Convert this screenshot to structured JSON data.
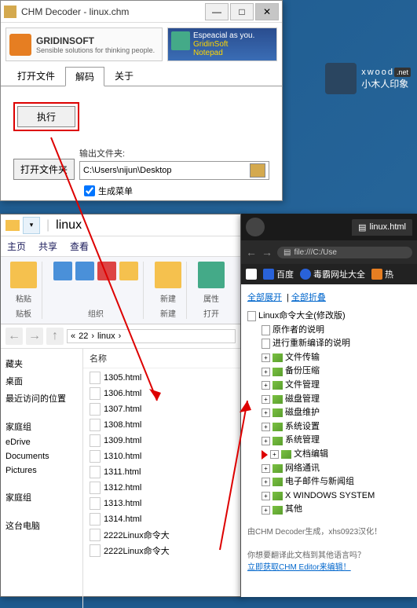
{
  "chm": {
    "title": "CHM Decoder - linux.chm",
    "banner": {
      "gridin": "GRIDINSOFT",
      "gridin_sub": "Sensible solutions for thinking people.",
      "esp": "Espeacial as you.",
      "gn1": "GridinSoft",
      "gn2": "Notepad"
    },
    "tabs": {
      "open": "打开文件",
      "decode": "解码",
      "about": "关于"
    },
    "execute": "执行",
    "open_folder": "打开文件夹",
    "output_label": "输出文件夹:",
    "path": "C:\\Users\\nijun\\Desktop",
    "gen_menu": "生成菜单"
  },
  "explorer": {
    "title": "linux",
    "ribbon_tabs": {
      "home": "主页",
      "share": "共享",
      "view": "查看"
    },
    "groups": {
      "clip": "贴板",
      "org": "组织",
      "new": "新建",
      "open": "打开"
    },
    "new_btn": "新建",
    "prop_btn": "属性",
    "paste_btn": "粘贴",
    "breadcrumb1": "22",
    "breadcrumb2": "linux",
    "nav": {
      "fav": "藏夹",
      "desktop": "桌面",
      "recent": "最近访问的位置",
      "home": "家庭组",
      "edrive": "eDrive",
      "docs": "Documents",
      "pics": "Pictures",
      "hg": "家庭组",
      "pc": "这台电脑"
    },
    "col_name": "名称",
    "files": [
      "1305.html",
      "1306.html",
      "1307.html",
      "1308.html",
      "1309.html",
      "1310.html",
      "1311.html",
      "1312.html",
      "1313.html",
      "1314.html",
      "2222Linux命令大",
      "2222Linux命令大"
    ]
  },
  "browser": {
    "tab_title": "linux.html",
    "url": "file:///C:/Use",
    "bookmarks": {
      "baidu": "百度",
      "duba": "毒霸网址大全",
      "re": "热"
    },
    "expand_all": "全部展开",
    "collapse_all": "全部折叠",
    "root": "Linux命令大全(修改版)",
    "items": {
      "author": "原作者的说明",
      "recompile": "进行重新编译的说明",
      "transfer": "文件传输",
      "backup": "备份压缩",
      "fileman": "文件管理",
      "diskman": "磁盘管理",
      "diskmaint": "磁盘维护",
      "sysset": "系统设置",
      "sysman": "系统管理",
      "docedit": "文档编辑",
      "netcom": "网络通讯",
      "email": "电子邮件与新闻组",
      "xwin": "X WINDOWS SYSTEM",
      "other": "其他"
    },
    "footer1": "由CHM Decoder生成，xhs0923汉化！",
    "footer2": "你想要翻译此文档到其他语言吗？",
    "footer3": "立即获取CHM Editor来编辑！"
  },
  "xwood": {
    "en": "xwood",
    "suf": ".net",
    "cn": "小木人印象"
  }
}
